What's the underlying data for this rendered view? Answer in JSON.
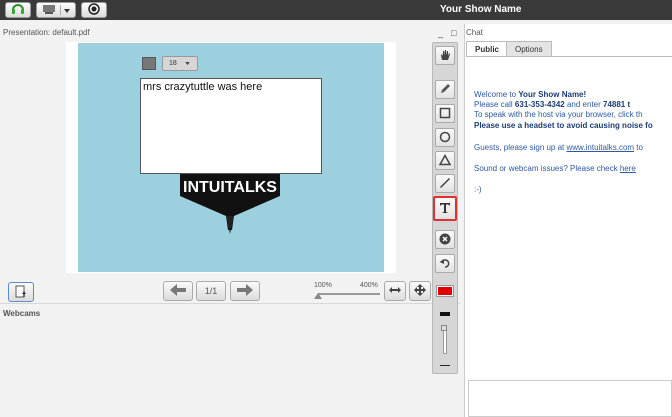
{
  "header": {
    "title": "Your Show Name"
  },
  "presentation": {
    "label": "Presentation: default.pdf",
    "ctrl_minimize": "_",
    "ctrl_maximize": "□",
    "font_size": "18",
    "text_content": "mrs crazytuttle was here",
    "logo_text": "INTUITALKS",
    "page_indicator": "1/1",
    "zoom_min": "100%",
    "zoom_max": "400%",
    "zoom_level": 0.0
  },
  "webcams": {
    "label": "Webcams"
  },
  "toolbar": {
    "pen_color": "#e00000",
    "tools": [
      "hand-icon",
      "pencil-icon",
      "rectangle-icon",
      "ellipse-icon",
      "triangle-icon",
      "line-icon",
      "text-icon",
      "clear-icon",
      "undo-icon"
    ]
  },
  "chat": {
    "title": "Chat",
    "tabs": [
      "Public",
      "Options"
    ],
    "welcome_prefix": "Welcome to ",
    "welcome_name": "Your Show Name!",
    "call_prefix": " Please call ",
    "phone": "631-353-4342",
    "call_mid": " and enter ",
    "code": "74881 t",
    "speak_line": "To speak with the host via your browser, click th",
    "headset_line": "Please use a headset to avoid causing noise fo",
    "signup_prefix": "Guests, please sign up at ",
    "signup_link": "www.intuitalks.com",
    "signup_suffix": " to",
    "issues_prefix": "Sound or webcam issues? Please check ",
    "issues_link": "here",
    "smiley": ":-)"
  }
}
